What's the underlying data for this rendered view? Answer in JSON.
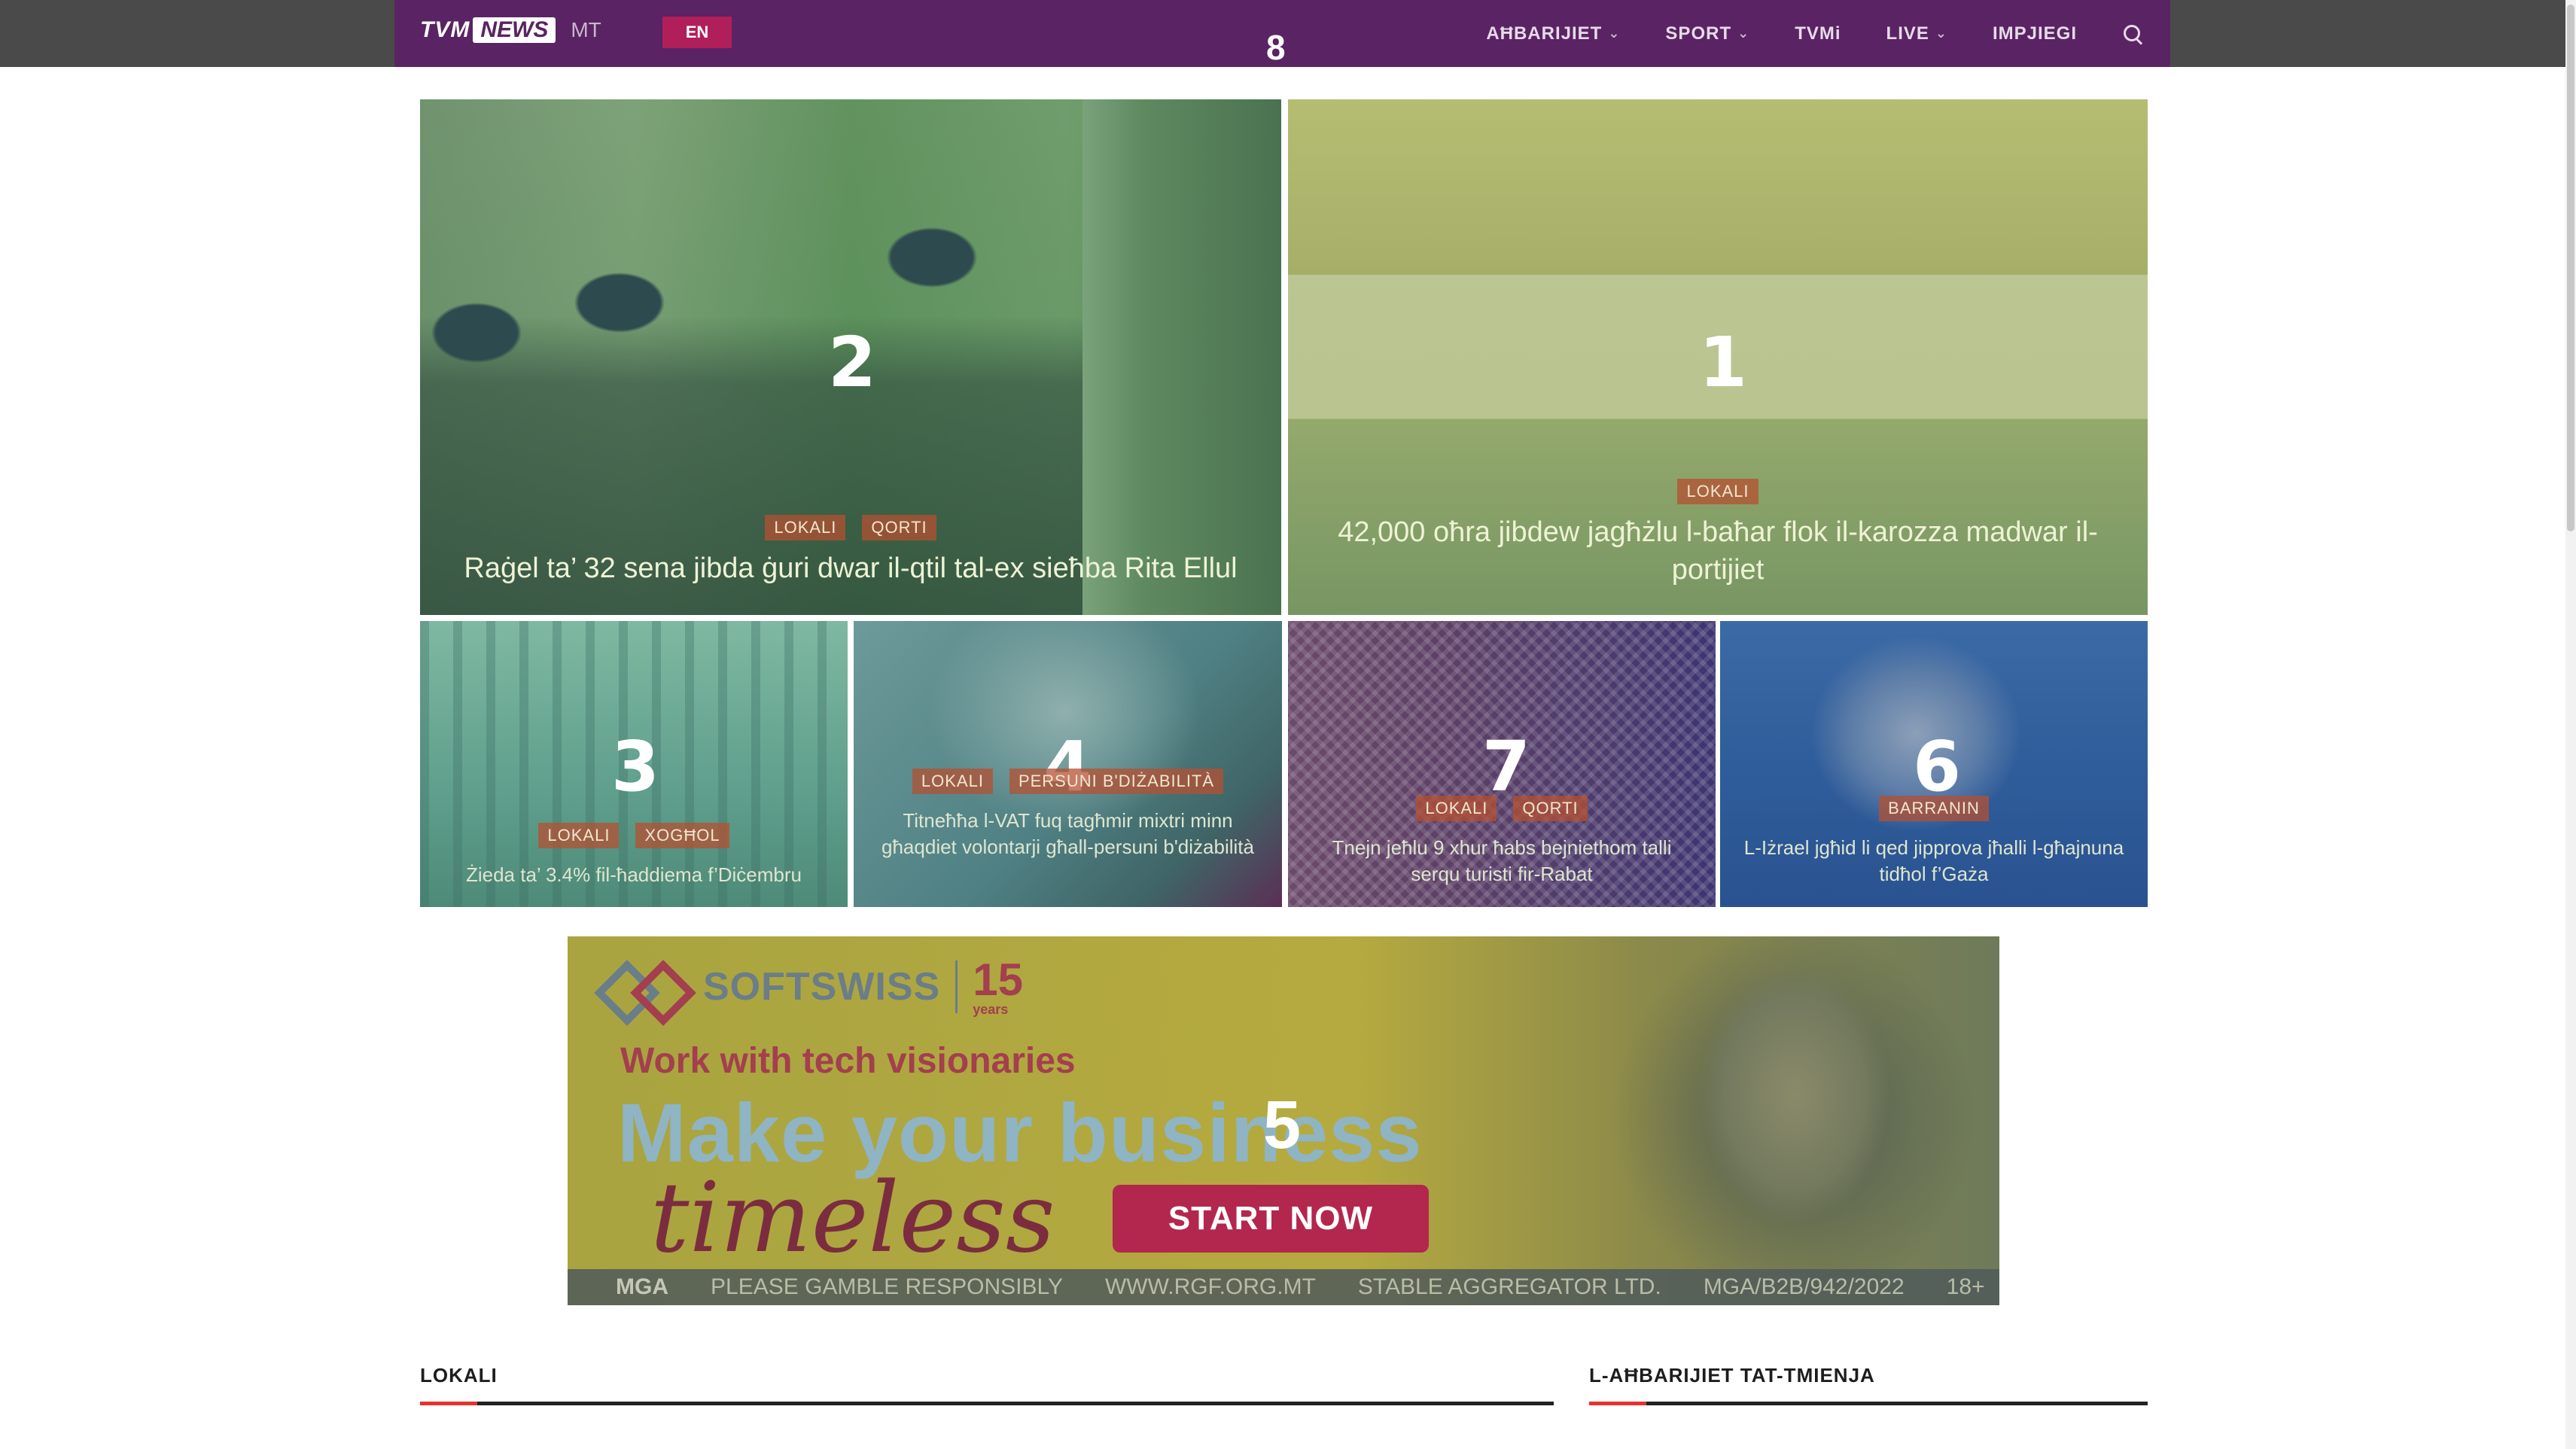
{
  "header": {
    "logo_tvm": "TVM",
    "logo_news": "NEWS",
    "logo_locale": "MT",
    "lang_button": "EN",
    "overlay_number": "8",
    "menu": [
      {
        "label": "AĦBARIJIET",
        "has_dropdown": true
      },
      {
        "label": "SPORT",
        "has_dropdown": true
      },
      {
        "label": "TVMi",
        "has_dropdown": false
      },
      {
        "label": "LIVE",
        "has_dropdown": true
      },
      {
        "label": "IMPJIEGI",
        "has_dropdown": false
      }
    ],
    "search_icon": "search-icon",
    "bg_color": "#5a2363"
  },
  "featured": [
    {
      "number": "2",
      "tags": [
        "LOKALI",
        "QORTI"
      ],
      "title": "Raġel ta’ 32 sena jibda ġuri dwar il-qtil tal-ex sieħba Rita Ellul"
    },
    {
      "number": "1",
      "tags": [
        "LOKALI"
      ],
      "title": "42,000 oħra jibdew jagħżlu l-baħar flok il-karozza madwar il-portijiet"
    },
    {
      "number": "3",
      "tags": [
        "LOKALI",
        "XOGĦOL"
      ],
      "title": "Żieda ta’ 3.4% fil-ħaddiema f’Diċembru"
    },
    {
      "number": "4",
      "tags": [
        "LOKALI",
        "PERSUNI B'DIŻABILITÀ"
      ],
      "title": "Titneħħa l-VAT fuq tagħmir mixtri minn għaqdiet volontarji għall-persuni b'diżabilità"
    },
    {
      "number": "7",
      "tags": [
        "LOKALI",
        "QORTI"
      ],
      "title": "Tnejn jeħlu 9 xhur ħabs bejniethom talli serqu turisti fir-Rabat"
    },
    {
      "number": "6",
      "tags": [
        "BARRANIN"
      ],
      "title": "L-Iżrael jgħid li qed jipprova jħalli l-għajnuna tidħol f’Gaża"
    }
  ],
  "ad": {
    "number": "5",
    "brand": "SOFTSWISS",
    "years": "15",
    "years_label": "years",
    "line1": "Work with tech visionaries",
    "line2": "Make your business",
    "line3": "timeless",
    "cta": "START NOW",
    "footer": [
      "MGA",
      "PLEASE GAMBLE RESPONSIBLY",
      "WWW.RGF.ORG.MT",
      "STABLE AGGREGATOR LTD.",
      "MGA/B2B/942/2022",
      "18+"
    ]
  },
  "sections": {
    "left": "LOKALI",
    "right": "L-AĦBARIJIET TAT-TMIENJA"
  },
  "colors": {
    "accent_red": "#e8322f",
    "tag_bg": "#b45032",
    "cta_bg": "#b3274f"
  }
}
